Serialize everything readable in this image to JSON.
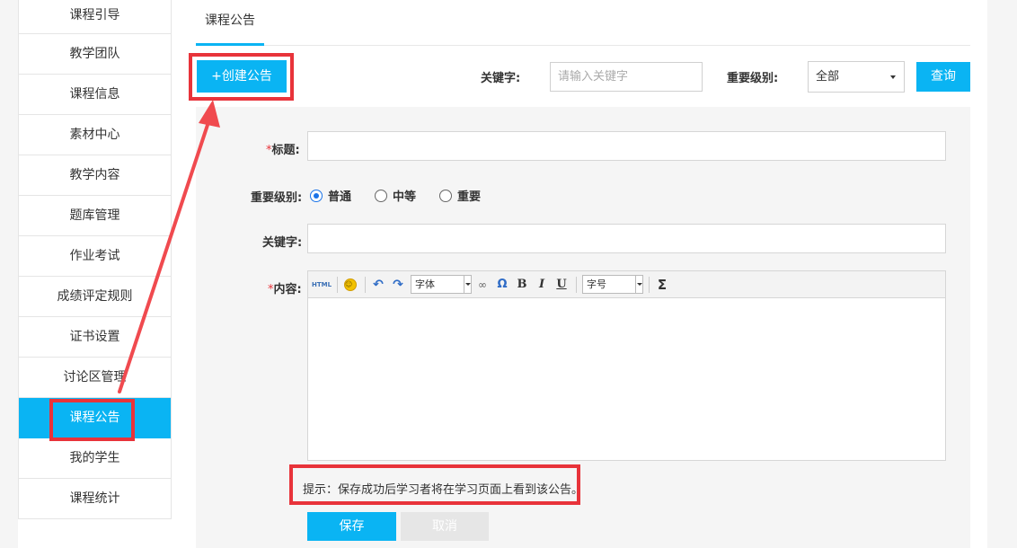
{
  "sidebar": {
    "items": [
      {
        "label": "课程引导"
      },
      {
        "label": "教学团队"
      },
      {
        "label": "课程信息"
      },
      {
        "label": "素材中心"
      },
      {
        "label": "教学内容"
      },
      {
        "label": "题库管理"
      },
      {
        "label": "作业考试"
      },
      {
        "label": "成绩评定规则"
      },
      {
        "label": "证书设置"
      },
      {
        "label": "讨论区管理"
      },
      {
        "label": "课程公告",
        "active": true
      },
      {
        "label": "我的学生"
      },
      {
        "label": "课程统计"
      }
    ]
  },
  "tabs": [
    {
      "label": "课程公告"
    }
  ],
  "toolbar": {
    "create_label": "+创建公告",
    "keyword_label": "关键字:",
    "keyword_placeholder": "请输入关键字",
    "level_label": "重要级别:",
    "level_value": "全部",
    "query_label": "查询"
  },
  "form": {
    "required_mark": "*",
    "title_label": "标题:",
    "level_label": "重要级别:",
    "levels": [
      {
        "label": "普通",
        "checked": true
      },
      {
        "label": "中等",
        "checked": false
      },
      {
        "label": "重要",
        "checked": false
      }
    ],
    "keyword_label": "关键字:",
    "content_label": "内容:",
    "editor": {
      "html_label": "HTML",
      "font_label": "字体",
      "size_label": "字号",
      "bold": "B",
      "italic": "I",
      "underline": "U",
      "omega": "Ω",
      "sigma": "Σ"
    },
    "hint": "提示：保存成功后学习者将在学习页面上看到该公告。",
    "save_label": "保存",
    "cancel_label": "取消"
  },
  "colors": {
    "accent": "#0ab4f3",
    "annotation": "#e8333a"
  }
}
